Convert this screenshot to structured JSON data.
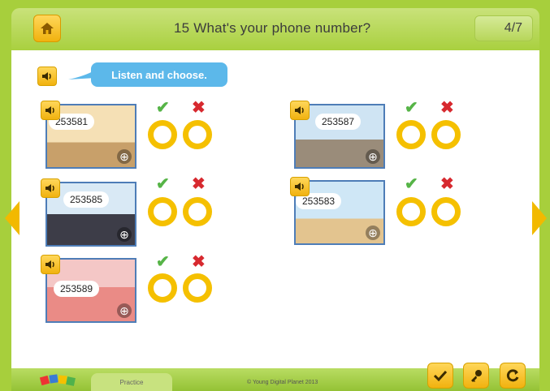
{
  "header": {
    "title": "15 What's your phone number?",
    "page_indicator": "4/7"
  },
  "instruction": "Listen and choose.",
  "items": [
    {
      "number": "253581"
    },
    {
      "number": "253587"
    },
    {
      "number": "253585"
    },
    {
      "number": "253583"
    },
    {
      "number": "253589"
    }
  ],
  "marks": {
    "correct": "✔",
    "wrong": "✖"
  },
  "footer": {
    "tab_label": "Practice",
    "copyright": "© Young Digital Planet 2013"
  },
  "icons": {
    "home": "home-icon",
    "speaker": "speaker-icon",
    "zoom": "zoom-icon",
    "check": "check-icon",
    "key": "key-icon",
    "reset": "reset-icon"
  },
  "colors": {
    "frame_green": "#a7cf3c",
    "button_yellow": "#f1b20f",
    "instruction_blue": "#5cb8ea",
    "correct_green": "#56b447",
    "wrong_red": "#d7292f"
  }
}
